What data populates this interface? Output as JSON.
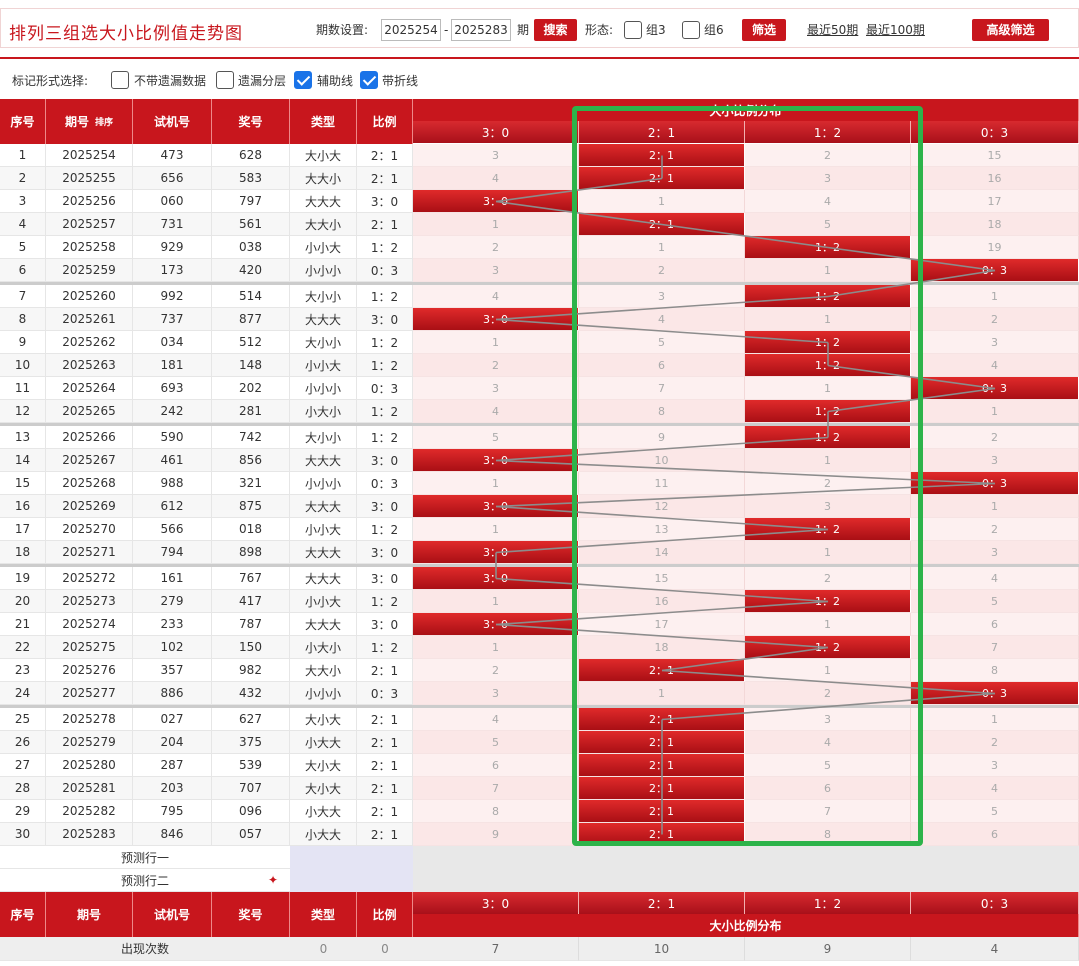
{
  "header": {
    "title": "排列三组选大小比例值走势图",
    "period_label": "期数设置:",
    "period_from": "2025254",
    "dash": "-",
    "period_to": "2025283",
    "period_unit": "期",
    "search_btn": "搜索",
    "form_label": "形态:",
    "g3_label": "组3",
    "g6_label": "组6",
    "filter_btn": "筛选",
    "recent50": "最近50期",
    "recent100": "最近100期",
    "advanced_btn": "高级筛选"
  },
  "options": {
    "label": "标记形式选择:",
    "items": [
      {
        "label": "不带遗漏数据",
        "checked": false
      },
      {
        "label": "遗漏分层",
        "checked": false
      },
      {
        "label": "辅助线",
        "checked": true
      },
      {
        "label": "带折线",
        "checked": true
      }
    ]
  },
  "table": {
    "columns": {
      "seq": "序号",
      "issue": "期号",
      "sort": "排序",
      "trial": "试机号",
      "prize": "奖号",
      "type": "类型",
      "ratio": "比例",
      "dist": "大小比例分布"
    },
    "dist_columns": [
      "3：0",
      "2：1",
      "1：2",
      "0：3"
    ],
    "predict1": "预测行一",
    "predict2": "预测行二",
    "count_label": "出现次数",
    "count_type": "0",
    "count_ratio": "0"
  },
  "colors": {
    "accent": "#c8161d",
    "highlight_box": "#2db34a",
    "line": "#8c8c8c"
  },
  "chart_data": {
    "type": "table",
    "title": "排列三组选大小比例值走势图",
    "categories": [
      "3：0",
      "2：1",
      "1：2",
      "0：3"
    ],
    "rows": [
      {
        "seq": "1",
        "issue": "2025254",
        "trial": "473",
        "prize": "628",
        "type": "大小大",
        "ratio": "2：1",
        "hit": 1,
        "miss": [
          "3",
          "",
          "2",
          "15"
        ]
      },
      {
        "seq": "2",
        "issue": "2025255",
        "trial": "656",
        "prize": "583",
        "type": "大大小",
        "ratio": "2：1",
        "hit": 1,
        "miss": [
          "4",
          "",
          "3",
          "16"
        ]
      },
      {
        "seq": "3",
        "issue": "2025256",
        "trial": "060",
        "prize": "797",
        "type": "大大大",
        "ratio": "3：0",
        "hit": 0,
        "miss": [
          "",
          "1",
          "4",
          "17"
        ]
      },
      {
        "seq": "4",
        "issue": "2025257",
        "trial": "731",
        "prize": "561",
        "type": "大大小",
        "ratio": "2：1",
        "hit": 1,
        "miss": [
          "1",
          "",
          "5",
          "18"
        ]
      },
      {
        "seq": "5",
        "issue": "2025258",
        "trial": "929",
        "prize": "038",
        "type": "小小大",
        "ratio": "1：2",
        "hit": 2,
        "miss": [
          "2",
          "1",
          "",
          "19"
        ]
      },
      {
        "seq": "6",
        "issue": "2025259",
        "trial": "173",
        "prize": "420",
        "type": "小小小",
        "ratio": "0：3",
        "hit": 3,
        "miss": [
          "3",
          "2",
          "1",
          ""
        ]
      },
      {
        "seq": "7",
        "issue": "2025260",
        "trial": "992",
        "prize": "514",
        "type": "大小小",
        "ratio": "1：2",
        "hit": 2,
        "miss": [
          "4",
          "3",
          "",
          "1"
        ]
      },
      {
        "seq": "8",
        "issue": "2025261",
        "trial": "737",
        "prize": "877",
        "type": "大大大",
        "ratio": "3：0",
        "hit": 0,
        "miss": [
          "",
          "4",
          "1",
          "2"
        ]
      },
      {
        "seq": "9",
        "issue": "2025262",
        "trial": "034",
        "prize": "512",
        "type": "大小小",
        "ratio": "1：2",
        "hit": 2,
        "miss": [
          "1",
          "5",
          "",
          "3"
        ]
      },
      {
        "seq": "10",
        "issue": "2025263",
        "trial": "181",
        "prize": "148",
        "type": "小小大",
        "ratio": "1：2",
        "hit": 2,
        "miss": [
          "2",
          "6",
          "",
          "4"
        ]
      },
      {
        "seq": "11",
        "issue": "2025264",
        "trial": "693",
        "prize": "202",
        "type": "小小小",
        "ratio": "0：3",
        "hit": 3,
        "miss": [
          "3",
          "7",
          "1",
          ""
        ]
      },
      {
        "seq": "12",
        "issue": "2025265",
        "trial": "242",
        "prize": "281",
        "type": "小大小",
        "ratio": "1：2",
        "hit": 2,
        "miss": [
          "4",
          "8",
          "",
          "1"
        ]
      },
      {
        "seq": "13",
        "issue": "2025266",
        "trial": "590",
        "prize": "742",
        "type": "大小小",
        "ratio": "1：2",
        "hit": 2,
        "miss": [
          "5",
          "9",
          "",
          "2"
        ]
      },
      {
        "seq": "14",
        "issue": "2025267",
        "trial": "461",
        "prize": "856",
        "type": "大大大",
        "ratio": "3：0",
        "hit": 0,
        "miss": [
          "",
          "10",
          "1",
          "3"
        ]
      },
      {
        "seq": "15",
        "issue": "2025268",
        "trial": "988",
        "prize": "321",
        "type": "小小小",
        "ratio": "0：3",
        "hit": 3,
        "miss": [
          "1",
          "11",
          "2",
          ""
        ]
      },
      {
        "seq": "16",
        "issue": "2025269",
        "trial": "612",
        "prize": "875",
        "type": "大大大",
        "ratio": "3：0",
        "hit": 0,
        "miss": [
          "",
          "12",
          "3",
          "1"
        ]
      },
      {
        "seq": "17",
        "issue": "2025270",
        "trial": "566",
        "prize": "018",
        "type": "小小大",
        "ratio": "1：2",
        "hit": 2,
        "miss": [
          "1",
          "13",
          "",
          "2"
        ]
      },
      {
        "seq": "18",
        "issue": "2025271",
        "trial": "794",
        "prize": "898",
        "type": "大大大",
        "ratio": "3：0",
        "hit": 0,
        "miss": [
          "",
          "14",
          "1",
          "3"
        ]
      },
      {
        "seq": "19",
        "issue": "2025272",
        "trial": "161",
        "prize": "767",
        "type": "大大大",
        "ratio": "3：0",
        "hit": 0,
        "miss": [
          "",
          "15",
          "2",
          "4"
        ]
      },
      {
        "seq": "20",
        "issue": "2025273",
        "trial": "279",
        "prize": "417",
        "type": "小小大",
        "ratio": "1：2",
        "hit": 2,
        "miss": [
          "1",
          "16",
          "",
          "5"
        ]
      },
      {
        "seq": "21",
        "issue": "2025274",
        "trial": "233",
        "prize": "787",
        "type": "大大大",
        "ratio": "3：0",
        "hit": 0,
        "miss": [
          "",
          "17",
          "1",
          "6"
        ]
      },
      {
        "seq": "22",
        "issue": "2025275",
        "trial": "102",
        "prize": "150",
        "type": "小大小",
        "ratio": "1：2",
        "hit": 2,
        "miss": [
          "1",
          "18",
          "",
          "7"
        ]
      },
      {
        "seq": "23",
        "issue": "2025276",
        "trial": "357",
        "prize": "982",
        "type": "大大小",
        "ratio": "2：1",
        "hit": 1,
        "miss": [
          "2",
          "",
          "1",
          "8"
        ]
      },
      {
        "seq": "24",
        "issue": "2025277",
        "trial": "886",
        "prize": "432",
        "type": "小小小",
        "ratio": "0：3",
        "hit": 3,
        "miss": [
          "3",
          "1",
          "2",
          ""
        ]
      },
      {
        "seq": "25",
        "issue": "2025278",
        "trial": "027",
        "prize": "627",
        "type": "大小大",
        "ratio": "2：1",
        "hit": 1,
        "miss": [
          "4",
          "",
          "3",
          "1"
        ]
      },
      {
        "seq": "26",
        "issue": "2025279",
        "trial": "204",
        "prize": "375",
        "type": "小大大",
        "ratio": "2：1",
        "hit": 1,
        "miss": [
          "5",
          "",
          "4",
          "2"
        ]
      },
      {
        "seq": "27",
        "issue": "2025280",
        "trial": "287",
        "prize": "539",
        "type": "大小大",
        "ratio": "2：1",
        "hit": 1,
        "miss": [
          "6",
          "",
          "5",
          "3"
        ]
      },
      {
        "seq": "28",
        "issue": "2025281",
        "trial": "203",
        "prize": "707",
        "type": "大小大",
        "ratio": "2：1",
        "hit": 1,
        "miss": [
          "7",
          "",
          "6",
          "4"
        ]
      },
      {
        "seq": "29",
        "issue": "2025282",
        "trial": "795",
        "prize": "096",
        "type": "小大大",
        "ratio": "2：1",
        "hit": 1,
        "miss": [
          "8",
          "",
          "7",
          "5"
        ]
      },
      {
        "seq": "30",
        "issue": "2025283",
        "trial": "846",
        "prize": "057",
        "type": "小大大",
        "ratio": "2：1",
        "hit": 1,
        "miss": [
          "9",
          "",
          "8",
          "6"
        ]
      }
    ],
    "counts": [
      "7",
      "10",
      "9",
      "4"
    ]
  }
}
